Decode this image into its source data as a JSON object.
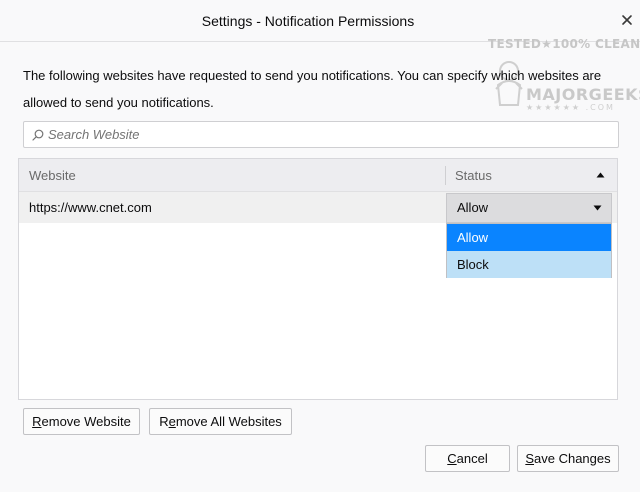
{
  "window": {
    "title": "Settings - Notification Permissions",
    "close_glyph": "✕"
  },
  "watermark": {
    "top_text": "TESTED★100% CLEAN",
    "name": "MAJORGEEKS",
    "domain_suffix": ".COM",
    "stars": "★★★★★★"
  },
  "description": "The following websites have requested to send you notifications. You can specify which websites are allowed to send you notifications.",
  "search": {
    "placeholder": "Search Website",
    "value": ""
  },
  "table": {
    "columns": [
      "Website",
      "Status"
    ],
    "rows": [
      {
        "website": "https://www.cnet.com",
        "status": "Allow"
      }
    ]
  },
  "dropdown": {
    "options": [
      "Allow",
      "Block"
    ],
    "highlighted": "Allow"
  },
  "buttons": {
    "remove_website": {
      "accel": "R",
      "rest": "emove Website"
    },
    "remove_all": {
      "pre": "R",
      "accel": "e",
      "rest": "move All Websites"
    },
    "cancel": {
      "accel": "C",
      "rest": "ancel"
    },
    "save": {
      "accel": "S",
      "rest": "ave Changes"
    }
  },
  "colors": {
    "accent": "#0a84ff",
    "option_hover": "#bde0f7",
    "background": "#f9f9fa"
  }
}
